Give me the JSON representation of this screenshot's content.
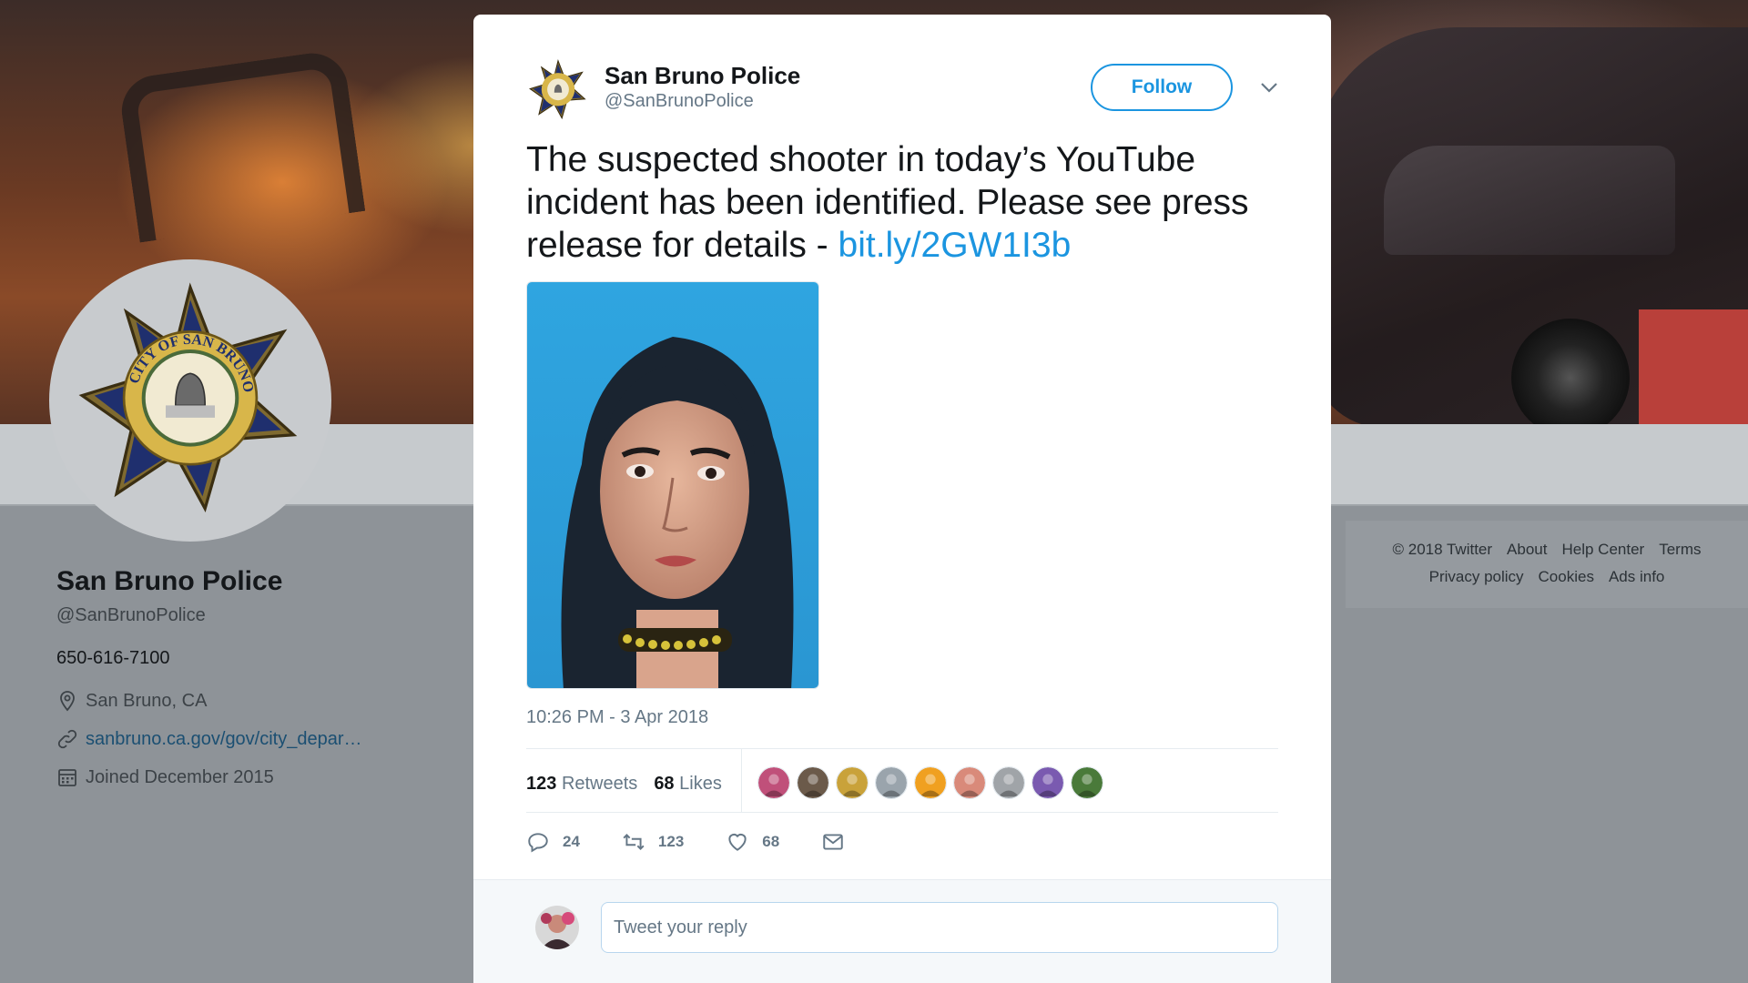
{
  "profile": {
    "name": "San Bruno Police",
    "handle": "@SanBrunoPolice",
    "phone": "650-616-7100",
    "location": "San Bruno, CA",
    "website": "sanbruno.ca.gov/gov/city_depar…",
    "joined": "Joined December 2015",
    "badge_text": "CITY OF SAN BRUNO"
  },
  "footer": {
    "line1": [
      "© 2018 Twitter",
      "About",
      "Help Center",
      "Terms"
    ],
    "line2": [
      "Privacy policy",
      "Cookies",
      "Ads info"
    ]
  },
  "tweet": {
    "author_name": "San Bruno Police",
    "author_handle": "@SanBrunoPolice",
    "follow_label": "Follow",
    "text": "The suspected shooter in today’s YouTube incident has been identified. Please see press release for details - ",
    "link_text": "bit.ly/2GW1I3b",
    "timestamp": "10:26 PM - 3 Apr 2018",
    "retweets_count": "123",
    "retweets_label": "Retweets",
    "likes_count": "68",
    "likes_label": "Likes",
    "actions": {
      "reply_count": "24",
      "retweet_count": "123",
      "like_count": "68"
    },
    "reply_placeholder": "Tweet your reply"
  },
  "colors": {
    "accent": "#1b95e0",
    "text_primary": "#14171a",
    "text_secondary": "#657786",
    "photo_background": "#2a9fdc"
  },
  "likers": [
    "#c0507a",
    "#6b5a4a",
    "#c9a23a",
    "#9aa4ac",
    "#f0a020",
    "#d98a7a",
    "#a0a4a8",
    "#7a5ab0",
    "#4a7a3a"
  ],
  "icons": [
    "reply-icon",
    "retweet-icon",
    "like-icon",
    "direct-message-icon",
    "location-icon",
    "link-icon",
    "calendar-icon",
    "chevron-down-icon",
    "police-badge-icon"
  ]
}
